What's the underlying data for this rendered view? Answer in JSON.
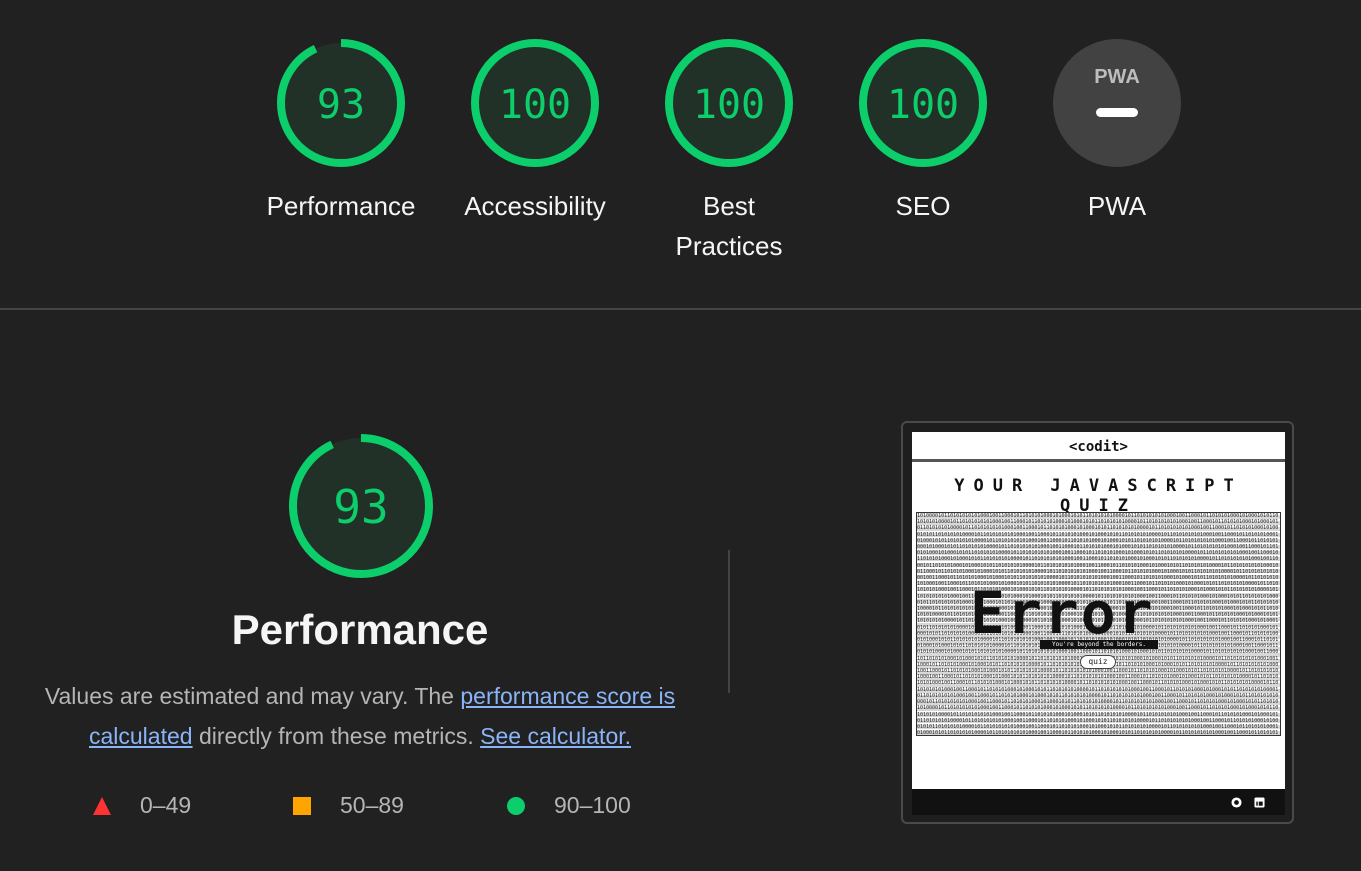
{
  "gauges": [
    {
      "label": "Performance",
      "score": "93",
      "value": 0.93,
      "color": "#0cce6b"
    },
    {
      "label": "Accessibility",
      "score": "100",
      "value": 1.0,
      "color": "#0cce6b"
    },
    {
      "label": "Best Practices",
      "score": "100",
      "value": 1.0,
      "color": "#0cce6b"
    },
    {
      "label": "SEO",
      "score": "100",
      "value": 1.0,
      "color": "#0cce6b"
    },
    {
      "label": "PWA",
      "badge": "PWA",
      "value": null,
      "color": "#424242"
    }
  ],
  "performance": {
    "score": "93",
    "value": 0.93,
    "title": "Performance",
    "desc_prefix": "Values are estimated and may vary. The ",
    "link_score": "performance score is calculated",
    "desc_middle": " directly from these metrics. ",
    "link_calc": "See calculator."
  },
  "legend": [
    {
      "range": "0–49",
      "shape": "triangle",
      "color": "#ff3333"
    },
    {
      "range": "50–89",
      "shape": "square",
      "color": "#ffa400"
    },
    {
      "range": "90–100",
      "shape": "circle",
      "color": "#0cce6b"
    }
  ],
  "screenshot": {
    "header": "<codit>",
    "quiz_title": "YOUR JAVASCRIPT QUIZ",
    "error_text": "Error",
    "message": "You're beyond the borders.",
    "button": "quiz",
    "footer_icons": [
      "github-icon",
      "linkedin-icon"
    ]
  }
}
